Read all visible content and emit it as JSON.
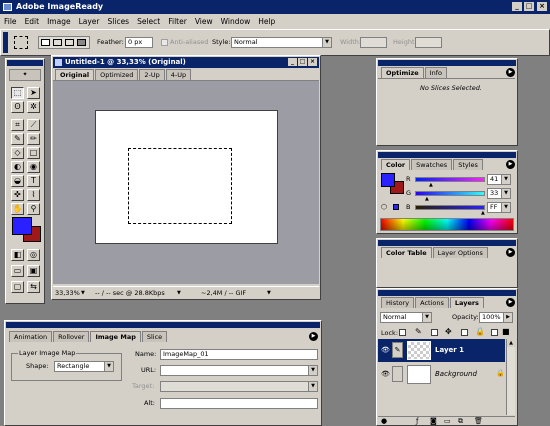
{
  "app_title": "Adobe ImageReady",
  "menu": [
    "File",
    "Edit",
    "Image",
    "Layer",
    "Slices",
    "Select",
    "Filter",
    "View",
    "Window",
    "Help"
  ],
  "options_bar": {
    "feather_label": "Feather:",
    "feather_value": "0 px",
    "antialiased_label": "Anti-aliased",
    "style_label": "Style:",
    "style_value": "Normal",
    "width_label": "Width:",
    "height_label": "Height:"
  },
  "document": {
    "title": "Untitled-1 @ 33,33% (Original)",
    "tabs": [
      "Original",
      "Optimized",
      "2-Up",
      "4-Up"
    ],
    "status": [
      "33,33%",
      "-- / -- sec @ 28.8Kbps",
      "~2,4M / -- GIF"
    ]
  },
  "optimize_panel": {
    "tabs": [
      "Optimize",
      "Info"
    ],
    "message": "No Slices Selected."
  },
  "color_panel": {
    "tabs": [
      "Color",
      "Swatches",
      "Styles"
    ],
    "channels": [
      {
        "name": "R",
        "value": "41"
      },
      {
        "name": "G",
        "value": "33"
      },
      {
        "name": "B",
        "value": "FF"
      }
    ],
    "fg_color": "#2921ff",
    "bg_color": "#a01818"
  },
  "color_table_panel": {
    "tabs": [
      "Color Table",
      "Layer Options"
    ]
  },
  "layers_panel": {
    "tabs": [
      "History",
      "Actions",
      "Layers"
    ],
    "blend_mode": "Normal",
    "opacity_label": "Opacity:",
    "opacity_value": "100%",
    "lock_label": "Lock:",
    "layers": [
      {
        "name": "Layer 1",
        "selected": true
      },
      {
        "name": "Background",
        "selected": false
      }
    ]
  },
  "imagemap_panel": {
    "tabs": [
      "Animation",
      "Rollover",
      "Image Map",
      "Slice"
    ],
    "group_label": "Layer Image Map",
    "shape_label": "Shape:",
    "shape_value": "Rectangle",
    "name_label": "Name:",
    "name_value": "ImageMap_01",
    "url_label": "URL:",
    "target_label": "Target:",
    "alt_label": "Alt:"
  }
}
